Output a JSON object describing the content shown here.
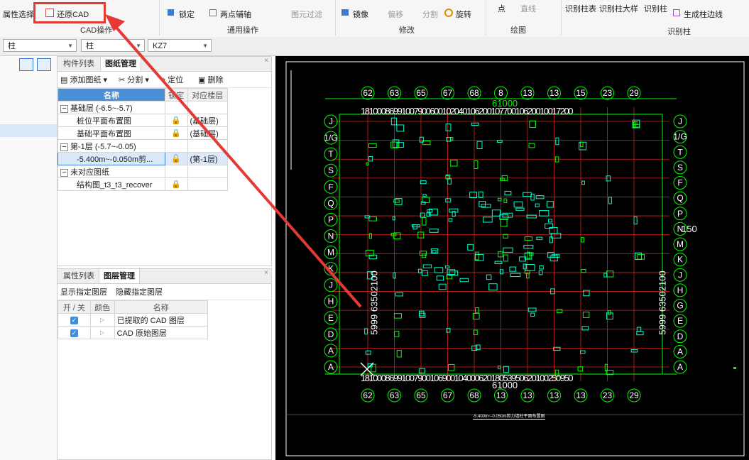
{
  "ribbon": {
    "items": {
      "attr_select": "属性选择",
      "restore_cad": "还原CAD",
      "lock": "锁定",
      "two_point_axis": "两点辅轴",
      "mirror": "镜像",
      "offset": "偏移",
      "split": "分割",
      "rotate": "旋转",
      "point": "点",
      "line": "直线",
      "identify_table": "识别柱表",
      "identify_detail": "识别柱大样",
      "identify_col": "识别柱",
      "gen_edge": "生成柱边线",
      "filter": "图元过滤"
    },
    "groups": {
      "cad_ops": "CAD操作",
      "common_ops": "通用操作",
      "modify": "修改",
      "draw": "绘图",
      "identify_column": "识别柱"
    }
  },
  "filterbar": {
    "combo1": "柱",
    "combo2": "柱",
    "combo3": "KZ7"
  },
  "panel_top": {
    "tabs": [
      "构件列表",
      "图纸管理"
    ],
    "tools": {
      "add": "添加图纸",
      "split": "分割",
      "locate": "定位",
      "delete": "删除"
    },
    "headers": {
      "name": "名称",
      "lock": "锁定",
      "floor": "对应楼层"
    },
    "rows": [
      {
        "toggle": "−",
        "name": "基础层 (-6.5~-5.7)",
        "floor": ""
      },
      {
        "toggle": "",
        "name": "桩位平面布置图",
        "floor": "(基础层)"
      },
      {
        "toggle": "",
        "name": "基础平面布置图",
        "floor": "(基础层)"
      },
      {
        "toggle": "−",
        "name": "第-1层 (-5.7~-0.05)",
        "floor": ""
      },
      {
        "toggle": "",
        "name": "-5.400m~-0.050m剪...",
        "floor": "(第-1层)"
      },
      {
        "toggle": "−",
        "name": "未对应图纸",
        "floor": ""
      },
      {
        "toggle": "",
        "name": "结构图_t3_t3_recover",
        "floor": ""
      }
    ]
  },
  "panel_bottom": {
    "tabs": [
      "属性列表",
      "图层管理"
    ],
    "tools": {
      "show": "显示指定图层",
      "hide": "隐藏指定图层"
    },
    "headers": {
      "toggle": "开 / 关",
      "color": "颜色",
      "name": "名称"
    },
    "rows": [
      {
        "name": "已提取的 CAD 图层"
      },
      {
        "name": "CAD 原始图层"
      }
    ]
  },
  "canvas": {
    "top_axes": [
      "62",
      "63",
      "65",
      "67",
      "68",
      "8",
      "13",
      "13",
      "15",
      "23",
      "29"
    ],
    "top_dims": "1810008699100790060010204010620010770010620010017200",
    "top_total": "61000",
    "bottom_axes": [
      "62",
      "63",
      "65",
      "67",
      "68",
      "13",
      "13",
      "13",
      "13",
      "23",
      "29"
    ],
    "bottom_dims": "1810008699100790010690010400062018053950620100250950",
    "bottom_total": "61000",
    "left_axes": [
      "J",
      "1/G",
      "T",
      "S",
      "F",
      "Q",
      "P",
      "N",
      "M",
      "K",
      "J",
      "H",
      "E",
      "D",
      "A",
      "A"
    ],
    "right_axes": [
      "J",
      "1/G",
      "T",
      "S",
      "F",
      "Q",
      "P",
      "N",
      "M",
      "K",
      "J",
      "H",
      "G",
      "E",
      "D",
      "A",
      "A"
    ],
    "left_dim": "5999 63502100",
    "right_dim": "5999 63502100",
    "right_extra": "150",
    "caption": "-5.400m~-0.050m剪力墙柱平面布置图",
    "colors": {
      "bg": "#000000",
      "axis": "#00ff00",
      "grid_red": "#d42020",
      "white": "#ffffff"
    }
  },
  "annotation": {
    "highlight_color": "#e53935"
  }
}
